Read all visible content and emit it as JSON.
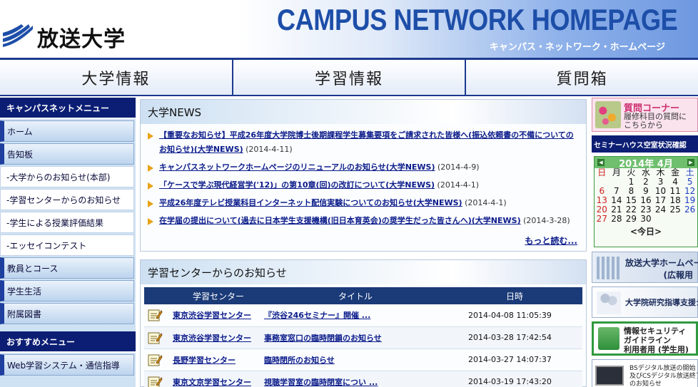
{
  "header": {
    "logo_text": "放送大学",
    "title": "CAMPUS NETWORK HOMEPAGE",
    "subtitle": "キャンパス・ネットワーク・ホームページ"
  },
  "main_nav": [
    {
      "label": "大学情報"
    },
    {
      "label": "学習情報"
    },
    {
      "label": "質問箱"
    }
  ],
  "sidebar": {
    "heading": "キャンパスネットメニュー",
    "items": [
      {
        "label": "ホーム",
        "type": "main"
      },
      {
        "label": "告知板",
        "type": "main"
      },
      {
        "label": "-大学からのお知らせ(本部)",
        "type": "sub"
      },
      {
        "label": "-学習センターからのお知らせ",
        "type": "sub"
      },
      {
        "label": "-学生による授業評価結果",
        "type": "sub"
      },
      {
        "label": "-エッセイコンテスト",
        "type": "sub"
      },
      {
        "label": "教員とコース",
        "type": "main"
      },
      {
        "label": "学生生活",
        "type": "main"
      },
      {
        "label": "附属図書",
        "type": "main"
      }
    ],
    "heading2": "おすすめメニュー",
    "items2": [
      {
        "label": "Web学習システム・通信指導"
      }
    ]
  },
  "news": {
    "title": "大学NEWS",
    "items": [
      {
        "text": "【重要なお知らせ】平成26年度大学院博士後期課程学生募集要項をご請求された皆様へ(振込依頼書の不備についてのお知らせ)(大学NEWS)",
        "date": "(2014-4-11)"
      },
      {
        "text": "キャンパスネットワークホームページのリニューアルのお知らせ(大学NEWS)",
        "date": "(2014-4-9)"
      },
      {
        "text": "「ケースで学ぶ現代経営学('12)」の第10章(回)の改訂について(大学NEWS)",
        "date": "(2014-4-1)"
      },
      {
        "text": "平成26年度テレビ授業科目インターネット配信実験についてのお知らせ(大学NEWS)",
        "date": "(2014-4-1)"
      },
      {
        "text": "在学届の提出について(過去に日本学生支援機構(旧日本育英会)の奨学生だった皆さんへ)(大学NEWS)",
        "date": "(2014-3-28)"
      }
    ],
    "more": "もっと読む..."
  },
  "learning_center": {
    "title": "学習センターからのお知らせ",
    "columns": [
      "学習センター",
      "タイトル",
      "日時"
    ],
    "rows": [
      {
        "center": "東京渋谷学習センター",
        "title": "『渋谷246セミナー』開催 ...",
        "datetime": "2014-04-08 11:05:39"
      },
      {
        "center": "東京渋谷学習センター",
        "title": "事務室窓口の臨時閉鎖のお知らせ",
        "datetime": "2014-03-28 17:42:54"
      },
      {
        "center": "長野学習センター",
        "title": "臨時閉所のお知らせ",
        "datetime": "2014-03-27 14:07:37"
      },
      {
        "center": "東京文京学習センター",
        "title": "視聴学習室の臨時閉室につい ...",
        "datetime": "2014-03-19 17:43:20"
      }
    ]
  },
  "right": {
    "qa_title": "質問コーナー",
    "qa_text1": "履修科目の質問に",
    "qa_text2": "こちらから",
    "seminar": "セミナーハウス空室状況確認",
    "calendar": {
      "month_label": "2014年 4月",
      "weekdays": [
        "日",
        "月",
        "火",
        "水",
        "木",
        "金",
        "土"
      ],
      "weeks": [
        [
          "",
          "",
          "1",
          "2",
          "3",
          "4",
          "5"
        ],
        [
          "6",
          "7",
          "8",
          "9",
          "10",
          "11",
          "12"
        ],
        [
          "13",
          "14",
          "15",
          "16",
          "17",
          "18",
          "19"
        ],
        [
          "20",
          "21",
          "22",
          "23",
          "24",
          "25",
          "26"
        ],
        [
          "27",
          "28",
          "29",
          "30",
          "",
          "",
          ""
        ]
      ],
      "today_label": "<今日>"
    },
    "banner_ouj_1": "放送大学ホームページ",
    "banner_ouj_2": "(広報用",
    "banner_grad": "大学院研究指導支援システ",
    "security_1": "情報セキュリティ",
    "security_2": "ガイドライン",
    "security_3": "利用者用 (学生用)",
    "bs_1": "BSデジタル放送の開始",
    "bs_2": "及びCSデジタル放送終了",
    "bs_3": "のお知らせ"
  },
  "colors": {
    "navy": "#0c1e74",
    "accent_blue": "#1d4ea8",
    "link": "#0b1b8a"
  }
}
